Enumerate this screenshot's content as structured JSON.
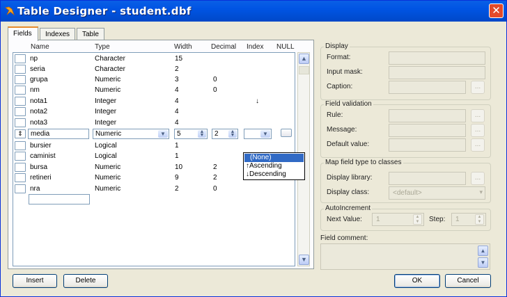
{
  "window": {
    "title": "Table Designer - student.dbf",
    "close_symbol": "✕"
  },
  "tabs": [
    "Fields",
    "Indexes",
    "Table"
  ],
  "columns": {
    "name": "Name",
    "type": "Type",
    "width": "Width",
    "decimal": "Decimal",
    "index": "Index",
    "null": "NULL"
  },
  "fields_top": [
    {
      "name": "np",
      "type": "Character",
      "width": "15",
      "decimal": "",
      "index": ""
    },
    {
      "name": "seria",
      "type": "Character",
      "width": "2",
      "decimal": "",
      "index": ""
    },
    {
      "name": "grupa",
      "type": "Numeric",
      "width": "3",
      "decimal": "0",
      "index": ""
    },
    {
      "name": "nm",
      "type": "Numeric",
      "width": "4",
      "decimal": "0",
      "index": ""
    },
    {
      "name": "nota1",
      "type": "Integer",
      "width": "4",
      "decimal": "",
      "index": "↓"
    },
    {
      "name": "nota2",
      "type": "Integer",
      "width": "4",
      "decimal": "",
      "index": ""
    },
    {
      "name": "nota3",
      "type": "Integer",
      "width": "4",
      "decimal": "",
      "index": ""
    }
  ],
  "selected_field": {
    "mover": "⇕",
    "name": "media",
    "type": "Numeric",
    "width": "5",
    "decimal": "2",
    "index": ""
  },
  "fields_bottom": [
    {
      "name": "bursier",
      "type": "Logical",
      "width": "1",
      "decimal": "",
      "index": ""
    },
    {
      "name": "caminist",
      "type": "Logical",
      "width": "1",
      "decimal": "",
      "index": ""
    },
    {
      "name": "bursa",
      "type": "Numeric",
      "width": "10",
      "decimal": "2",
      "index": ""
    },
    {
      "name": "retineri",
      "type": "Numeric",
      "width": "9",
      "decimal": "2",
      "index": ""
    },
    {
      "name": "nra",
      "type": "Numeric",
      "width": "2",
      "decimal": "0",
      "index": ""
    }
  ],
  "index_dropdown": [
    "(None)",
    "↑Ascending",
    "↓Descending"
  ],
  "buttons": {
    "insert": "Insert",
    "delete": "Delete",
    "ok": "OK",
    "cancel": "Cancel"
  },
  "display": {
    "legend": "Display",
    "format": "Format:",
    "input_mask": "Input mask:",
    "caption": "Caption:",
    "ellipsis": "..."
  },
  "validation": {
    "legend": "Field validation",
    "rule": "Rule:",
    "message": "Message:",
    "default_value": "Default value:"
  },
  "class_map": {
    "legend": "Map field type to classes",
    "display_library": "Display library:",
    "display_class": "Display class:",
    "display_class_value": "<default>"
  },
  "autoincrement": {
    "legend": "AutoIncrement",
    "next_value": "Next Value:",
    "next_value_value": "1",
    "step": "Step:",
    "step_value": "1"
  },
  "comment": {
    "label": "Field comment:"
  }
}
